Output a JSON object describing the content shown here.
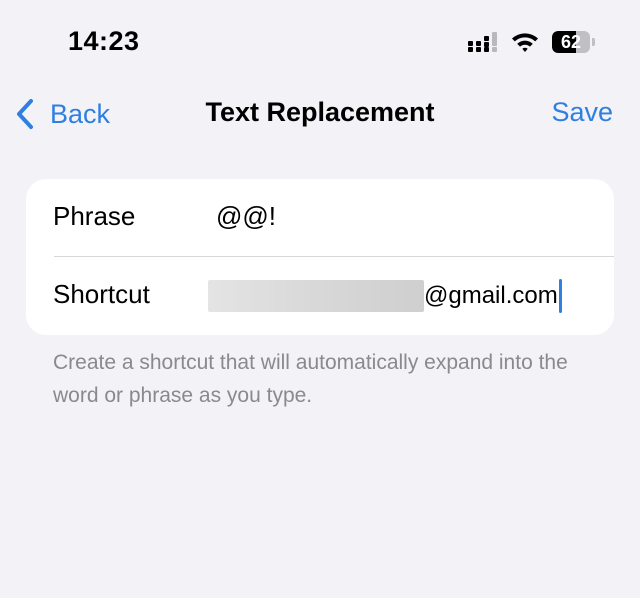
{
  "status_bar": {
    "time": "14:23",
    "battery_percent": 62,
    "battery_label": "62",
    "signal_icon": "cellular-signal-icon",
    "wifi_icon": "wifi-icon"
  },
  "nav": {
    "back_label": "Back",
    "title": "Text Replacement",
    "save_label": "Save",
    "accent_color": "#2f7fe0"
  },
  "form": {
    "phrase_label": "Phrase",
    "phrase_value": "@@!",
    "shortcut_label": "Shortcut",
    "shortcut_value_visible": "@gmail.com"
  },
  "footer": {
    "note": "Create a shortcut that will automatically expand into the word or phrase as you type."
  }
}
